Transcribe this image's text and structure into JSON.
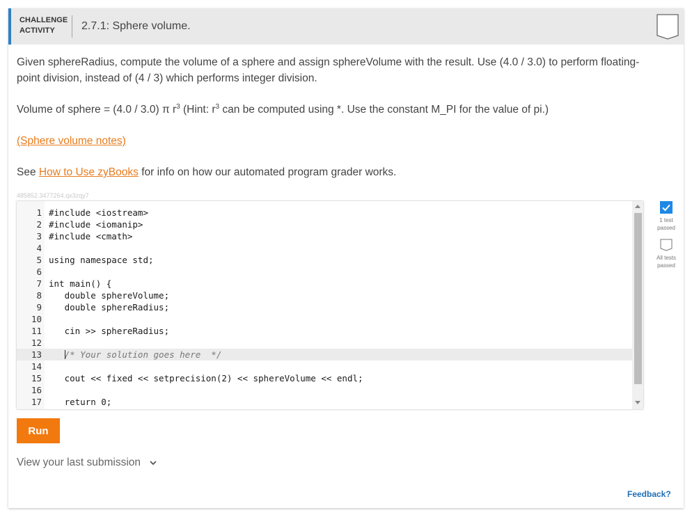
{
  "header": {
    "badge_line1": "CHALLENGE",
    "badge_line2": "ACTIVITY",
    "title": "2.7.1: Sphere volume."
  },
  "instructions": {
    "p1": "Given sphereRadius, compute the volume of a sphere and assign sphereVolume with the result. Use (4.0 / 3.0) to perform floating-point division, instead of (4 / 3) which performs integer division.",
    "p2_before": "Volume of sphere = (4.0 / 3.0) π r",
    "p2_sup": "3",
    "p2_mid": " (Hint: r",
    "p2_sup2": "3",
    "p2_after": " can be computed using *. Use the constant M_PI for the value of pi.)",
    "notes_link": "(Sphere volume notes)",
    "p4_before": "See ",
    "p4_link": "How to Use zyBooks",
    "p4_after": " for info on how our automated program grader works."
  },
  "activity_id": "485852.3477264.qx3zqy7",
  "editor": {
    "lines": [
      {
        "n": "1",
        "text": "#include <iostream>"
      },
      {
        "n": "2",
        "text": "#include <iomanip>"
      },
      {
        "n": "3",
        "text": "#include <cmath>"
      },
      {
        "n": "4",
        "text": ""
      },
      {
        "n": "5",
        "text": "using namespace std;"
      },
      {
        "n": "6",
        "text": ""
      },
      {
        "n": "7",
        "text": "int main() {"
      },
      {
        "n": "8",
        "text": "   double sphereVolume;"
      },
      {
        "n": "9",
        "text": "   double sphereRadius;"
      },
      {
        "n": "10",
        "text": ""
      },
      {
        "n": "11",
        "text": "   cin >> sphereRadius;"
      },
      {
        "n": "12",
        "text": ""
      },
      {
        "n": "13",
        "text": "   /* Your solution goes here  */"
      },
      {
        "n": "14",
        "text": ""
      },
      {
        "n": "15",
        "text": "   cout << fixed << setprecision(2) << sphereVolume << endl;"
      },
      {
        "n": "16",
        "text": ""
      },
      {
        "n": "17",
        "text": "   return 0;"
      }
    ]
  },
  "tests": {
    "test1_label_a": "1 test",
    "test1_label_b": "passed",
    "test2_label_a": "All tests",
    "test2_label_b": "passed"
  },
  "run_label": "Run",
  "last_submission_label": "View your last submission",
  "feedback_label": "Feedback?",
  "colors": {
    "accent_blue": "#2f80c1",
    "run_orange": "#f2790e",
    "link_orange": "#e87c1e",
    "check_blue": "#1e88e5"
  }
}
